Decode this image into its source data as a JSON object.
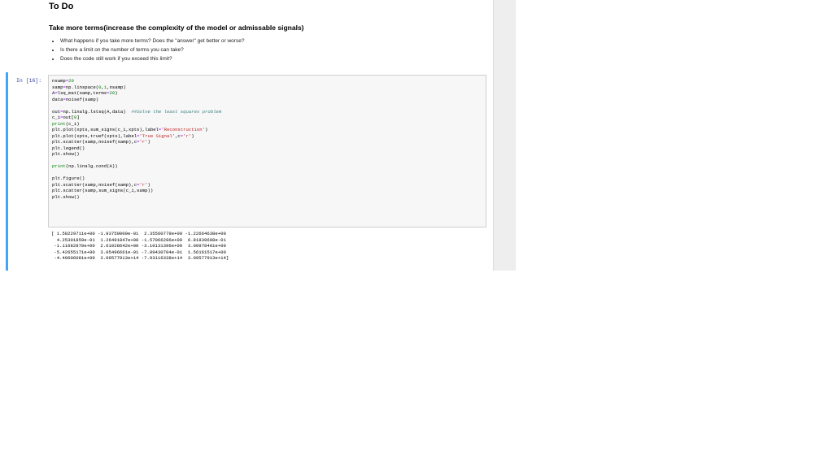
{
  "markdown": {
    "heading": "To Do",
    "subheading": "Take more terms(increase the complexity of the model or admissable signals)",
    "bullets": [
      "What happens if you take more terms? Does the \"answer\" get better or worse?",
      "Is there a limit on the number of terms you can take?",
      "Does the code still work if you exceed this limit?"
    ]
  },
  "cell": {
    "prompt": "In [16]:",
    "code_lines": [
      "nsamp=20",
      "samp=np.linspace(0,1,nsamp)",
      "A=lsq_mat(samp,terms=20)",
      "data=noisef(samp)",
      "",
      "out=np.linalg.lstsq(A,data)  ##Solve the least squares problem",
      "c_i=out[0]",
      "print(c_i)",
      "plt.plot(xpts,sum_signs(c_i,xpts),label='Reconstruction')",
      "plt.plot(xpts,truef(xpts),label='True Signal',c='r')",
      "plt.scatter(samp,noisef(samp),c='r')",
      "plt.legend()",
      "plt.show()",
      "",
      "print(np.linalg.cond(A))",
      "",
      "plt.figure()",
      "plt.scatter(samp,noisef(samp),c='r')",
      "plt.scatter(samp,sum_signs(c_i,samp))",
      "plt.show()"
    ],
    "output_lines": [
      "[ 1.58229711e+00 -1.93750000e-01  2.35560778e+00 -1.22664638e+00",
      "  4.25301859e-01  1.26491847e+00 -1.57066286e+00  6.81839608e-01",
      " -1.11682870e+00  2.61028642e+00 -3.10131396e+00  3.00978401e+00",
      " -5.42655171e+00  3.05496661e-01 -7.89430704e-01  1.56161517e+00",
      " -4.40606081e+00  3.09577913e+14 -7.93116338e+14  3.09577913e+14]"
    ]
  }
}
